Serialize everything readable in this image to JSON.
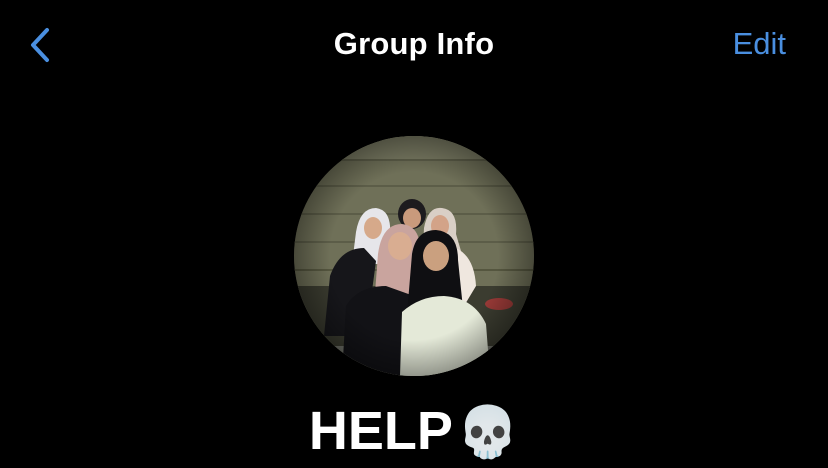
{
  "nav": {
    "back_icon": "chevron-left-icon",
    "title": "Group Info",
    "edit_label": "Edit"
  },
  "group": {
    "photo_icon": "group-photo",
    "name": "HELP",
    "name_emoji": "💀"
  },
  "colors": {
    "background": "#000000",
    "accent": "#4a8fe0",
    "text": "#ffffff"
  }
}
